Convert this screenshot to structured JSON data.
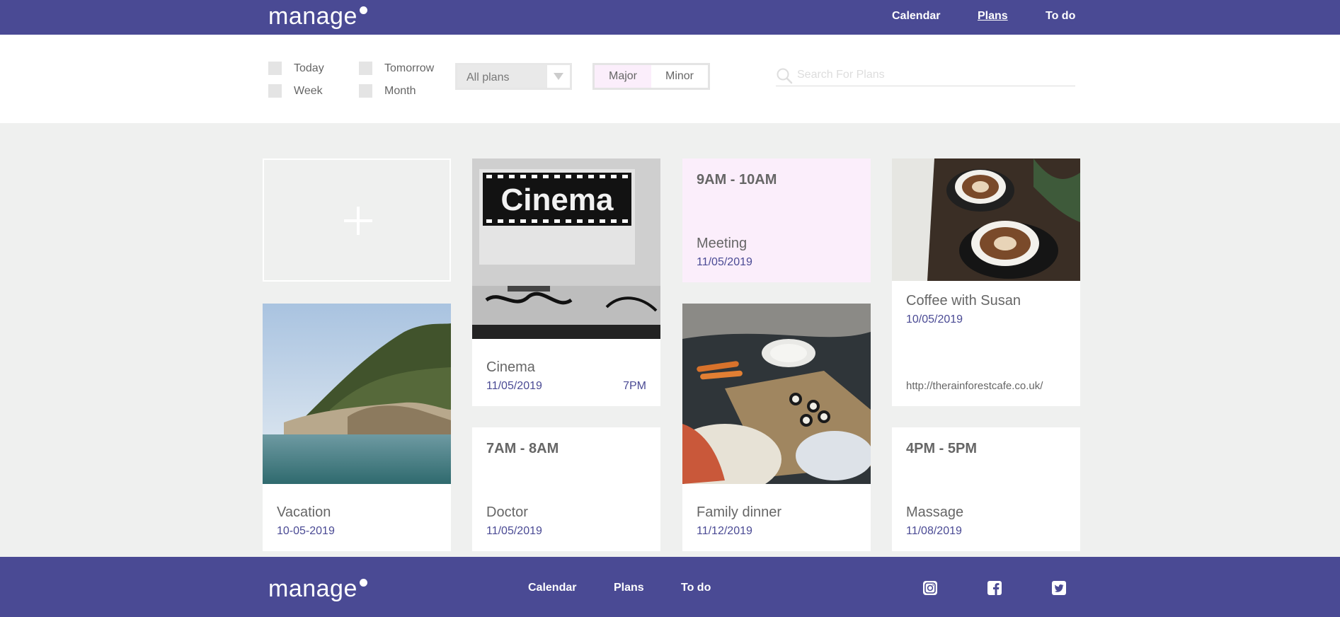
{
  "header": {
    "logo": "manage",
    "nav": [
      "Calendar",
      "Plans",
      "To do"
    ],
    "active_nav": "Plans"
  },
  "filters": {
    "checkboxes": [
      "Today",
      "Week",
      "Tomorrow",
      "Month"
    ],
    "select_value": "All plans",
    "toggle": {
      "major": "Major",
      "minor": "Minor",
      "selected": "Major"
    },
    "search_placeholder": "Search For Plans"
  },
  "cards": {
    "add_icon": "plus-icon",
    "vacation": {
      "title": "Vacation",
      "date": "10-05-2019",
      "image": "sea-cliff-photo"
    },
    "cinema": {
      "title": "Cinema",
      "date": "11/05/2019",
      "time": "7PM",
      "image": "cinema-sign-photo",
      "sign_text": "Cinema"
    },
    "doctor": {
      "time": "7AM - 8AM",
      "title": "Doctor",
      "date": "11/05/2019"
    },
    "meeting": {
      "time": "9AM - 10AM",
      "title": "Meeting",
      "date": "11/05/2019"
    },
    "family": {
      "title": "Family dinner",
      "date": "11/12/2019",
      "image": "dinner-table-photo"
    },
    "coffee": {
      "title": "Coffee with Susan",
      "date": "10/05/2019",
      "link": "http://therainforestcafe.co.uk/",
      "image": "coffee-cups-photo"
    },
    "massage": {
      "time": "4PM - 5PM",
      "title": "Massage",
      "date": "11/08/2019"
    }
  },
  "footer": {
    "logo": "manage",
    "nav": [
      "Calendar",
      "Plans",
      "To do"
    ],
    "social": [
      "instagram-icon",
      "facebook-icon",
      "twitter-icon"
    ]
  },
  "colors": {
    "brand": "#4a4a94",
    "background": "#eff0ef",
    "meeting_card": "#fbeefb"
  }
}
